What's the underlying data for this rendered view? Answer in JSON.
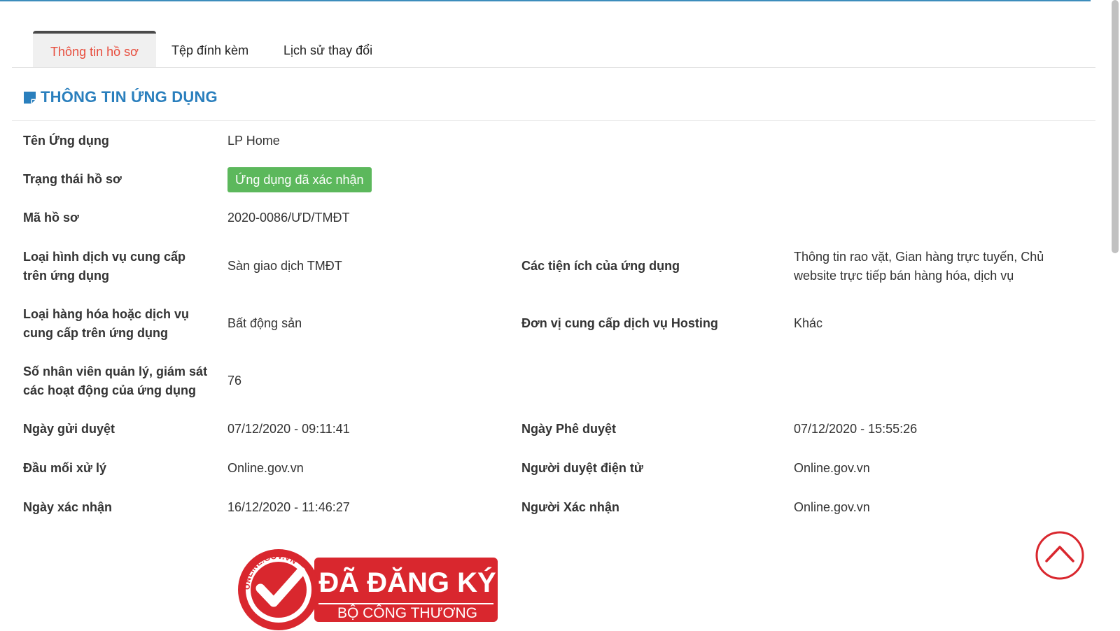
{
  "tabs": [
    {
      "label": "Thông tin hồ sơ",
      "active": true
    },
    {
      "label": "Tệp đính kèm",
      "active": false
    },
    {
      "label": "Lịch sử thay đổi",
      "active": false
    }
  ],
  "section": {
    "title": "THÔNG TIN ỨNG DỤNG",
    "icon": "edit-note-icon"
  },
  "fields": {
    "app_name": {
      "label": "Tên Ứng dụng",
      "value": "LP Home"
    },
    "status": {
      "label": "Trạng thái hồ sơ",
      "value": "Ứng dụng đã xác nhận"
    },
    "code": {
      "label": "Mã hồ sơ",
      "value": "2020-0086/ƯD/TMĐT"
    },
    "service_type": {
      "label": "Loại hình dịch vụ cung cấp trên ứng dụng",
      "value": "Sàn giao dịch TMĐT"
    },
    "features": {
      "label": "Các tiện ích của ứng dụng",
      "value": "Thông tin rao vặt, Gian hàng trực tuyến, Chủ website trực tiếp bán hàng hóa, dịch vụ"
    },
    "goods_type": {
      "label": "Loại hàng hóa hoặc dịch vụ cung cấp trên ứng dụng",
      "value": "Bất động sản"
    },
    "hosting": {
      "label": "Đơn vị cung cấp dịch vụ Hosting",
      "value": "Khác"
    },
    "staff": {
      "label": "Số nhân viên quản lý, giám sát các hoạt động của ứng dụng",
      "value": "76"
    },
    "submit_date": {
      "label": "Ngày gửi duyệt",
      "value": "07/12/2020 - 09:11:41"
    },
    "approve_date": {
      "label": "Ngày Phê duyệt",
      "value": "07/12/2020 - 15:55:26"
    },
    "handler": {
      "label": "Đầu mối xử lý",
      "value": "Online.gov.vn"
    },
    "e_approver": {
      "label": "Người duyệt điện tử",
      "value": "Online.gov.vn"
    },
    "confirm_date": {
      "label": "Ngày xác nhận",
      "value": "16/12/2020 - 11:46:27"
    },
    "confirmer": {
      "label": "Người Xác nhận",
      "value": "Online.gov.vn"
    }
  },
  "seal": {
    "ring_text": "ONLINE.GOV.VN",
    "title": "ĐÃ ĐĂNG KÝ",
    "subtitle": "BỘ CÔNG THƯƠNG"
  },
  "colors": {
    "accent": "#2a7fbd",
    "active_tab": "#e74c3c",
    "badge": "#5cb85c",
    "seal": "#d9272e"
  }
}
